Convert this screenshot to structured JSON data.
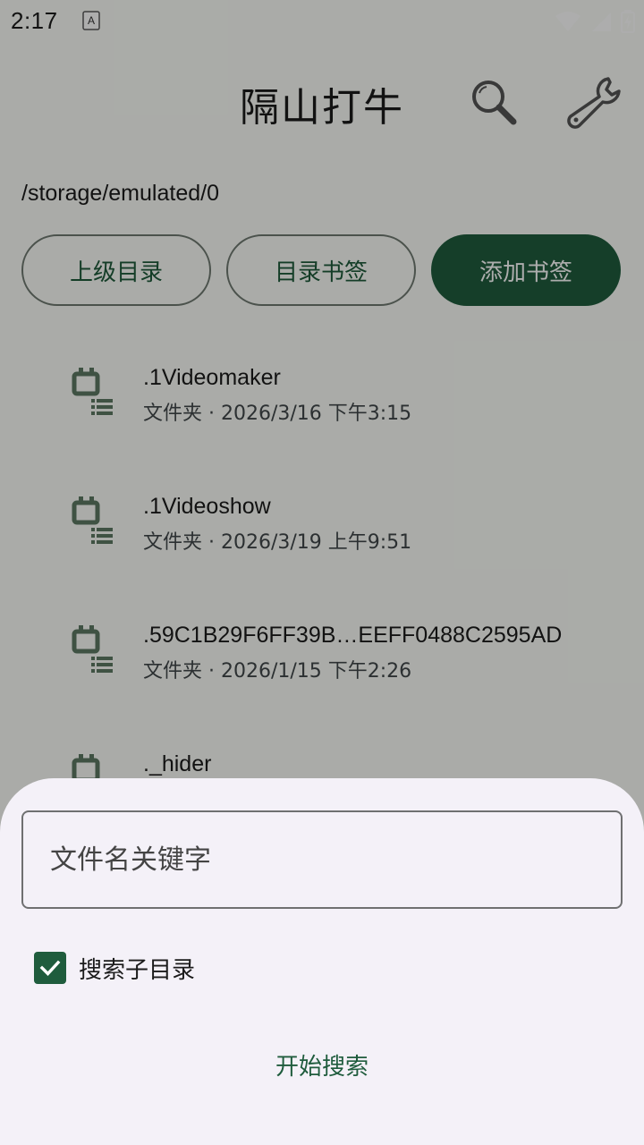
{
  "status_bar": {
    "time": "2:17"
  },
  "header": {
    "title": "隔山打牛",
    "search_icon": "search-icon",
    "settings_icon": "wrench-icon"
  },
  "path": "/storage/emulated/0",
  "buttons": {
    "parent_dir": "上级目录",
    "dir_bookmarks": "目录书签",
    "add_bookmark": "添加书签"
  },
  "files": [
    {
      "name": ".1Videomaker",
      "meta": "文件夹 · 2026/3/16 下午3:15"
    },
    {
      "name": ".1Videoshow",
      "meta": "文件夹 · 2026/3/19 上午9:51"
    },
    {
      "name": ".59C1B29F6FF39B…EEFF0488C2595AD",
      "meta": "文件夹 · 2026/1/15 下午2:26"
    },
    {
      "name": "._hider",
      "meta": ""
    }
  ],
  "sheet": {
    "search_placeholder": "文件名关键字",
    "search_value": "",
    "include_subdirs_label": "搜索子目录",
    "include_subdirs_checked": true,
    "start_label": "开始搜索"
  },
  "colors": {
    "primary": "#1f5c3d",
    "background": "#fbfdf8",
    "sheet": "#f4f1f8",
    "folder_icon": "#5d7a63"
  }
}
